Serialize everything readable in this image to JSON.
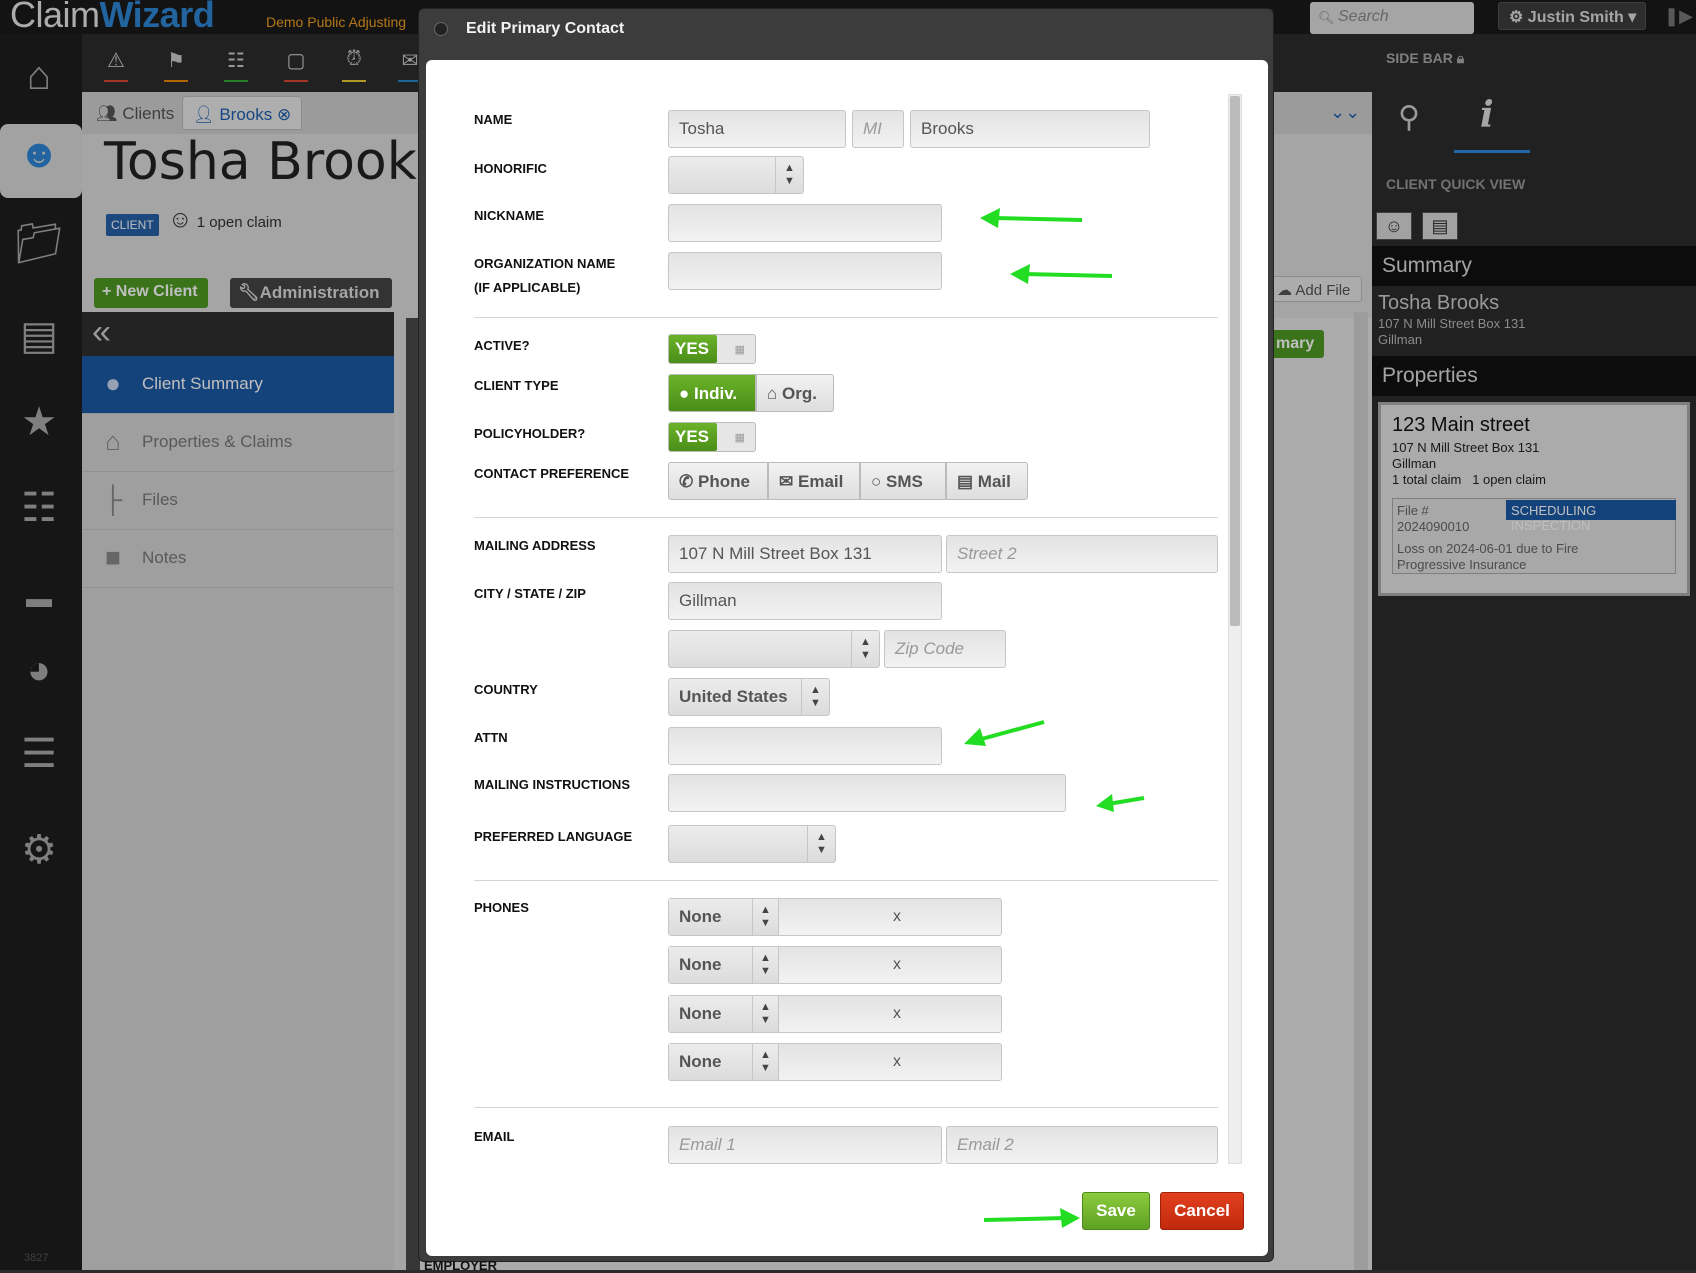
{
  "app": {
    "logo_part1": "Claim",
    "logo_part2": "Wizard",
    "company": "Demo Public Adjusting",
    "search_placeholder": "Search",
    "user": "Justin Smith",
    "rail_number": "3827"
  },
  "tabs": [
    {
      "label": "Clients"
    },
    {
      "label": "Brooks"
    }
  ],
  "client": {
    "name": "Tosha Brooks",
    "badge": "CLIENT",
    "open_claims": "1 open claim"
  },
  "toolbar": {
    "new_client": "+ New Client",
    "administration": "Administration",
    "add_file": "Add File",
    "summary_partial": "mary"
  },
  "leftnav": [
    {
      "label": "Client Summary"
    },
    {
      "label": "Properties & Claims"
    },
    {
      "label": "Files"
    },
    {
      "label": "Notes"
    }
  ],
  "sidebar": {
    "title": "SIDE BAR",
    "quick_view": "CLIENT QUICK VIEW",
    "summary_header": "Summary",
    "summary_name": "Tosha Brooks",
    "summary_addr1": "107 N Mill Street Box 131",
    "summary_city": "Gillman",
    "properties_header": "Properties",
    "property": {
      "name": "123 Main street",
      "addr1": "107 N Mill Street Box 131",
      "city": "Gillman",
      "counts": "1 total claim   1 open claim",
      "file_label": "File #",
      "file_number": "2024090010",
      "status": "SCHEDULING INSPECTION",
      "loss": "Loss on 2024-06-01 due to Fire",
      "insurer": "Progressive Insurance"
    }
  },
  "modal": {
    "title": "Edit Primary Contact",
    "labels": {
      "name": "NAME",
      "honorific": "HONORIFIC",
      "nickname": "NICKNAME",
      "org_name_1": "ORGANIZATION NAME",
      "org_name_2": "(IF APPLICABLE)",
      "active": "ACTIVE?",
      "client_type": "CLIENT TYPE",
      "policyholder": "POLICYHOLDER?",
      "contact_pref": "CONTACT PREFERENCE",
      "mailing_address": "MAILING ADDRESS",
      "city_state_zip": "CITY / STATE / ZIP",
      "country": "COUNTRY",
      "attn": "ATTN",
      "mailing_instructions": "MAILING INSTRUCTIONS",
      "preferred_language": "PREFERRED LANGUAGE",
      "phones": "PHONES",
      "email": "EMAIL",
      "employer": "EMPLOYER"
    },
    "fields": {
      "first_name": "Tosha",
      "mi_placeholder": "MI",
      "last_name": "Brooks",
      "street1": "107 N Mill Street Box 131",
      "street2_placeholder": "Street 2",
      "city": "Gillman",
      "zip_placeholder": "Zip Code",
      "country": "United States",
      "email1_placeholder": "Email 1",
      "email2_placeholder": "Email 2"
    },
    "toggles": {
      "active": "YES",
      "policyholder": "YES"
    },
    "client_type": [
      {
        "label": "Indiv."
      },
      {
        "label": "Org."
      }
    ],
    "contact_pref": [
      {
        "label": "Phone"
      },
      {
        "label": "Email"
      },
      {
        "label": "SMS"
      },
      {
        "label": "Mail"
      }
    ],
    "phones": [
      {
        "type": "None",
        "ext": "x"
      },
      {
        "type": "None",
        "ext": "x"
      },
      {
        "type": "None",
        "ext": "x"
      },
      {
        "type": "None",
        "ext": "x"
      }
    ],
    "save": "Save",
    "cancel": "Cancel"
  },
  "colors": {
    "accent": "#2e86d4",
    "green": "#5ea123",
    "red": "#c02a0c",
    "arrow": "#22dd22"
  }
}
